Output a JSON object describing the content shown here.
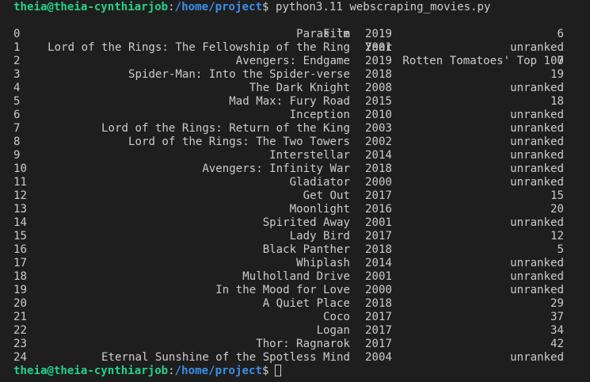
{
  "prompt": {
    "user_host": "theia@theia-cynthiarjob",
    "separator": ":",
    "path": "/home/project",
    "symbol": "$"
  },
  "command": "python3.11 webscraping_movies.py",
  "table": {
    "headers": {
      "film": "Film",
      "year": "Year",
      "top": "Rotten Tomatoes' Top 100"
    },
    "rows": [
      {
        "idx": "0",
        "film": "Parasite",
        "year": "2019",
        "top": "6"
      },
      {
        "idx": "1",
        "film": "Lord of the Rings: The Fellowship of the Ring",
        "year": "2001",
        "top": "unranked"
      },
      {
        "idx": "2",
        "film": "Avengers: Endgame",
        "year": "2019",
        "top": "7"
      },
      {
        "idx": "3",
        "film": "Spider-Man: Into the Spider-verse",
        "year": "2018",
        "top": "19"
      },
      {
        "idx": "4",
        "film": "The Dark Knight",
        "year": "2008",
        "top": "unranked"
      },
      {
        "idx": "5",
        "film": "Mad Max: Fury Road",
        "year": "2015",
        "top": "18"
      },
      {
        "idx": "6",
        "film": "Inception",
        "year": "2010",
        "top": "unranked"
      },
      {
        "idx": "7",
        "film": "Lord of the Rings: Return of the King",
        "year": "2003",
        "top": "unranked"
      },
      {
        "idx": "8",
        "film": "Lord of the Rings: The Two Towers",
        "year": "2002",
        "top": "unranked"
      },
      {
        "idx": "9",
        "film": "Interstellar",
        "year": "2014",
        "top": "unranked"
      },
      {
        "idx": "10",
        "film": "Avengers: Infinity War",
        "year": "2018",
        "top": "unranked"
      },
      {
        "idx": "11",
        "film": "Gladiator",
        "year": "2000",
        "top": "unranked"
      },
      {
        "idx": "12",
        "film": "Get Out",
        "year": "2017",
        "top": "15"
      },
      {
        "idx": "13",
        "film": "Moonlight",
        "year": "2016",
        "top": "20"
      },
      {
        "idx": "14",
        "film": "Spirited Away",
        "year": "2001",
        "top": "unranked"
      },
      {
        "idx": "15",
        "film": "Lady Bird",
        "year": "2017",
        "top": "12"
      },
      {
        "idx": "16",
        "film": "Black Panther",
        "year": "2018",
        "top": "5"
      },
      {
        "idx": "17",
        "film": "Whiplash",
        "year": "2014",
        "top": "unranked"
      },
      {
        "idx": "18",
        "film": "Mulholland Drive",
        "year": "2001",
        "top": "unranked"
      },
      {
        "idx": "19",
        "film": "In the Mood for Love",
        "year": "2000",
        "top": "unranked"
      },
      {
        "idx": "20",
        "film": "A Quiet Place",
        "year": "2018",
        "top": "29"
      },
      {
        "idx": "21",
        "film": "Coco",
        "year": "2017",
        "top": "37"
      },
      {
        "idx": "22",
        "film": "Logan",
        "year": "2017",
        "top": "34"
      },
      {
        "idx": "23",
        "film": "Thor: Ragnarok",
        "year": "2017",
        "top": "42"
      },
      {
        "idx": "24",
        "film": "Eternal Sunshine of the Spotless Mind",
        "year": "2004",
        "top": "unranked"
      }
    ]
  },
  "colors": {
    "background": "#1e1e1e",
    "text": "#cccccc",
    "user_host": "#23d18b",
    "path": "#3b8eea"
  }
}
